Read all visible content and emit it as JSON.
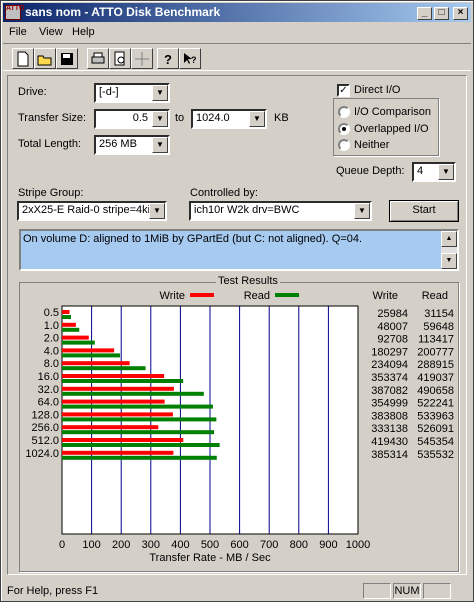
{
  "window": {
    "title": "sans nom - ATTO Disk Benchmark"
  },
  "menu": {
    "file": "File",
    "view": "View",
    "help": "Help"
  },
  "drive": {
    "label": "Drive:",
    "value": "[-d-]"
  },
  "transfer_size": {
    "label": "Transfer Size:",
    "from": "0.5",
    "to_label": "to",
    "to": "1024.0",
    "unit": "KB"
  },
  "total_length": {
    "label": "Total Length:",
    "value": "256 MB"
  },
  "direct_io": {
    "label": "Direct I/O",
    "checked": true
  },
  "io_mode": {
    "comparison": "I/O Comparison",
    "overlapped": "Overlapped I/O",
    "neither": "Neither",
    "selected": "overlapped"
  },
  "queue_depth": {
    "label": "Queue Depth:",
    "value": "4"
  },
  "stripe_group": {
    "label": "Stripe Group:",
    "value": "2xX25-E Raid-0 stripe=4kiB"
  },
  "controlled_by": {
    "label": "Controlled by:",
    "value": "ich10r W2k drv=BWC"
  },
  "start_button": "Start",
  "description": "On volume D: aligned to 1MiB by GPartEd (but C: not aligned). Q=04.",
  "results": {
    "title": "Test Results",
    "write_header": "Write",
    "read_header": "Read"
  },
  "colors": {
    "write": "#ff0000",
    "read": "#008000",
    "grid": "#00008b",
    "title_start": "#0a246a",
    "title_end": "#a6caf0"
  },
  "chart_data": {
    "type": "bar",
    "categories": [
      "0.5",
      "1.0",
      "2.0",
      "4.0",
      "8.0",
      "16.0",
      "32.0",
      "64.0",
      "128.0",
      "256.0",
      "512.0",
      "1024.0"
    ],
    "series": [
      {
        "name": "Write",
        "values": [
          25984,
          48007,
          92708,
          180297,
          234094,
          353374,
          387082,
          354999,
          383808,
          333138,
          419430,
          385314
        ]
      },
      {
        "name": "Read",
        "values": [
          31154,
          59648,
          113417,
          200777,
          288915,
          419037,
          490658,
          522241,
          533963,
          526091,
          545354,
          535532
        ]
      }
    ],
    "xlabel": "Transfer Rate - MB / Sec",
    "xticks": [
      "0",
      "100",
      "200",
      "300",
      "400",
      "500",
      "600",
      "700",
      "800",
      "900",
      "1000"
    ],
    "xlim": [
      0,
      1000
    ],
    "legend": "top"
  },
  "status": {
    "text": "For Help, press F1",
    "num": "NUM"
  }
}
